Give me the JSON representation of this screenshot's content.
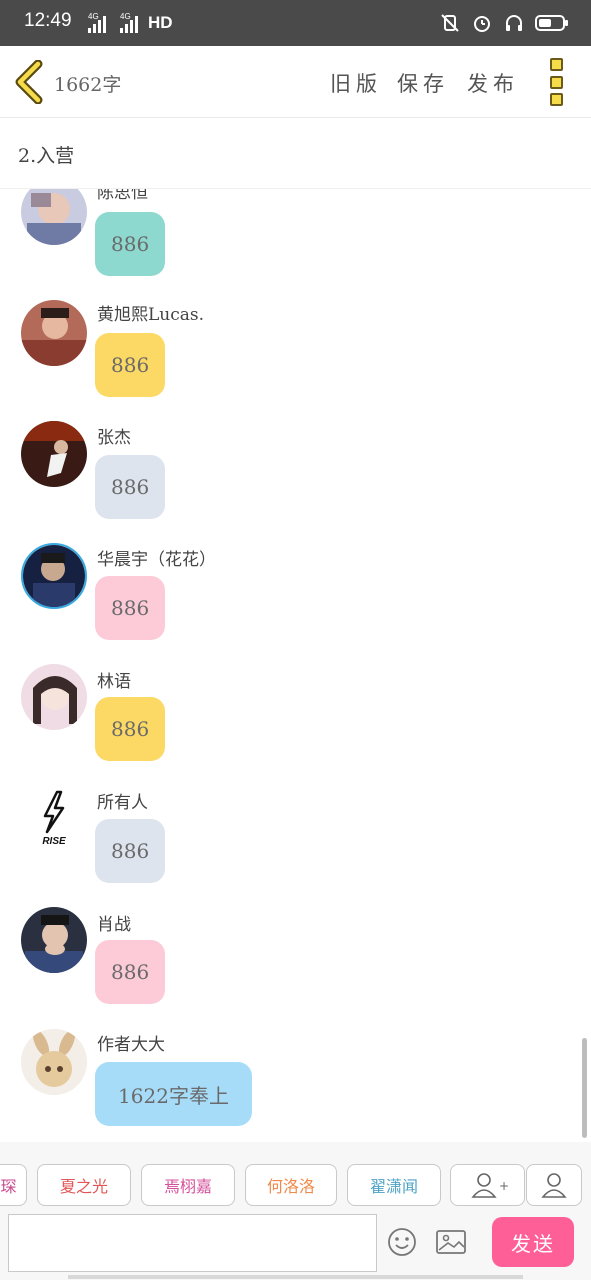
{
  "status_bar": {
    "time": "12:49",
    "sim1": "4G",
    "sim2": "4G",
    "hd": "HD",
    "icons": [
      "vibrate-off-icon",
      "alarm-icon",
      "headset-icon",
      "battery-icon"
    ]
  },
  "header": {
    "word_count": "1662字",
    "old_version": "旧版",
    "save": "保存",
    "publish": "发布"
  },
  "chapter_title": "2.入营",
  "messages": [
    {
      "name": "陈思恒",
      "text": "886",
      "bubble_color": "#8dd9cf"
    },
    {
      "name": "黄旭熙Lucas.",
      "text": "886",
      "bubble_color": "#fcd964"
    },
    {
      "name": "张杰",
      "text": "886",
      "bubble_color": "#dde4ee"
    },
    {
      "name": "华晨宇（花花）",
      "text": "886",
      "bubble_color": "#fdcbd8"
    },
    {
      "name": "林语",
      "text": "886",
      "bubble_color": "#fcd964"
    },
    {
      "name": "所有人",
      "text": "886",
      "bubble_color": "#dde4ee",
      "avatar_text": "RISE"
    },
    {
      "name": "肖战",
      "text": "886",
      "bubble_color": "#fdcbd8"
    },
    {
      "name": "作者大大",
      "text": "1622字奉上",
      "bubble_color": "#a6dcf8"
    }
  ],
  "chips": [
    {
      "label": "琛",
      "color": "#c94a8e"
    },
    {
      "label": "夏之光",
      "color": "#e25555"
    },
    {
      "label": "焉栩嘉",
      "color": "#d64f9b"
    },
    {
      "label": "何洛洛",
      "color": "#f08a4b"
    },
    {
      "label": "翟潇闻",
      "color": "#4fa3c6"
    }
  ],
  "chip_icons": {
    "add_person": "add-person-icon",
    "add_plus": "+",
    "person": "person-icon"
  },
  "input": {
    "value": "",
    "placeholder": ""
  },
  "send_label": "发送",
  "colors": {
    "send": "#ff5f97",
    "accent": "#f6dc4a"
  }
}
